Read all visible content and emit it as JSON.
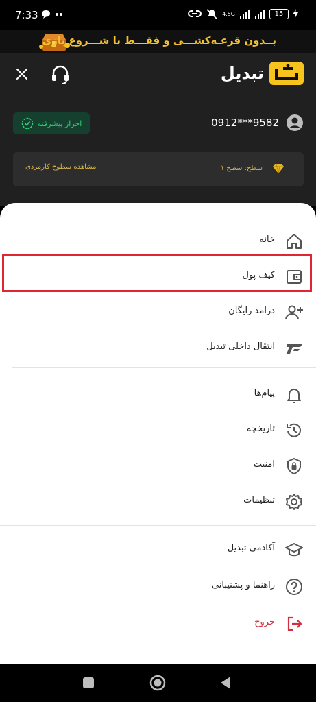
{
  "status": {
    "time": "7:33",
    "network": "4.5G",
    "battery": "15"
  },
  "banner": {
    "text": "بــدون قرعـه‌کشـــی و فقـــط با شـــروع بازی"
  },
  "header": {
    "brand_name": "تبدیل",
    "verify_label": "احراز پیشرفته",
    "phone": "0912***9582",
    "level_text": "سطح: سطح ۱",
    "level_link": "مشاهده سطوح کارمزدی"
  },
  "menu": {
    "home": "خانه",
    "wallet": "کیف پول",
    "referral": "درامد رایگان",
    "transfer": "انتقال داخلی تبدیل",
    "messages": "پیام‌ها",
    "history": "تاریخچه",
    "security": "امنیت",
    "settings": "تنظیمات",
    "academy": "آکادمی تبدیل",
    "support": "راهنما و پشتیبانی",
    "logout": "خروج"
  },
  "colors": {
    "brand_yellow": "#f7c31d",
    "verify_green": "#2ecc71",
    "logout_red": "#d32f3f",
    "highlight_red": "#e0262f"
  }
}
